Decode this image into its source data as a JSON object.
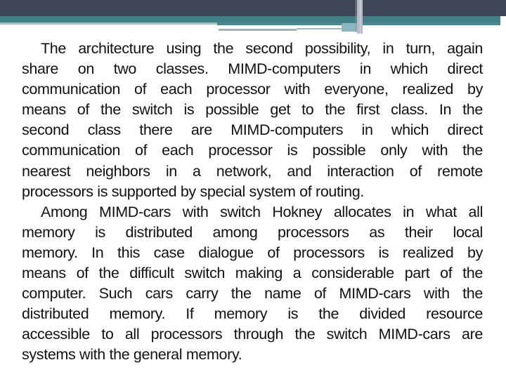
{
  "colors": {
    "header_dark": "#3f4656",
    "header_teal": "#428088",
    "text": "#111111",
    "background": "#ffffff"
  },
  "document": {
    "paragraphs": [
      {
        "lines": [
          "The architecture using the second possibility, in turn, again",
          "share on two classes. MIMD-computers in which direct",
          "communication of each processor with everyone, realized by",
          "means of the switch is possible get to the first class. In the",
          "second class there are MIMD-computers in which direct",
          "communication of each processor is possible only with the",
          "nearest neighbors in a network, and interaction of remote",
          "processors is supported by special system of routing."
        ]
      },
      {
        "lines": [
          "Among MIMD-cars with switch Hokney allocates in what all",
          "memory is distributed among processors as their local",
          "memory. In this case dialogue of processors is realized by",
          "means of the difficult switch making a considerable part of the",
          "computer. Such cars carry the name of MIMD-cars with the",
          "distributed memory. If memory is the divided resource",
          "accessible to all processors through the switch MIMD-cars are",
          "systems with the general memory."
        ]
      }
    ]
  }
}
